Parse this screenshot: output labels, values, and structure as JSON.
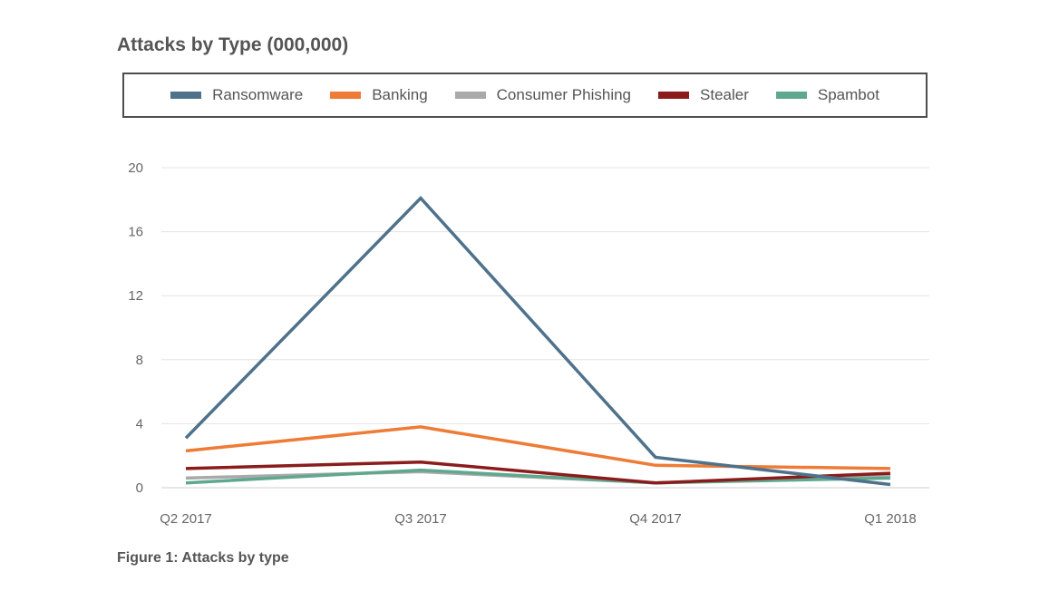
{
  "title": "Attacks by Type (000,000)",
  "caption": "Figure 1: Attacks by type",
  "chart_data": {
    "type": "line",
    "title": "Attacks by Type (000,000)",
    "xlabel": "",
    "ylabel": "",
    "categories": [
      "Q2 2017",
      "Q3 2017",
      "Q4 2017",
      "Q1 2018"
    ],
    "ylim": [
      0,
      20
    ],
    "yticks": [
      0,
      4,
      8,
      12,
      16,
      20
    ],
    "grid": true,
    "legend_position": "top",
    "series": [
      {
        "name": "Ransomware",
        "color": "#4f728c",
        "values": [
          3.1,
          18.1,
          1.9,
          0.2
        ]
      },
      {
        "name": "Banking",
        "color": "#ee7b36",
        "values": [
          2.3,
          3.8,
          1.4,
          1.2
        ]
      },
      {
        "name": "Consumer Phishing",
        "color": "#a9a9a9",
        "values": [
          0.6,
          1.0,
          0.3,
          0.8
        ]
      },
      {
        "name": "Stealer",
        "color": "#8b1c1c",
        "values": [
          1.2,
          1.6,
          0.3,
          0.9
        ]
      },
      {
        "name": "Spambot",
        "color": "#5fa88e",
        "values": [
          0.3,
          1.1,
          0.3,
          0.6
        ]
      }
    ]
  }
}
